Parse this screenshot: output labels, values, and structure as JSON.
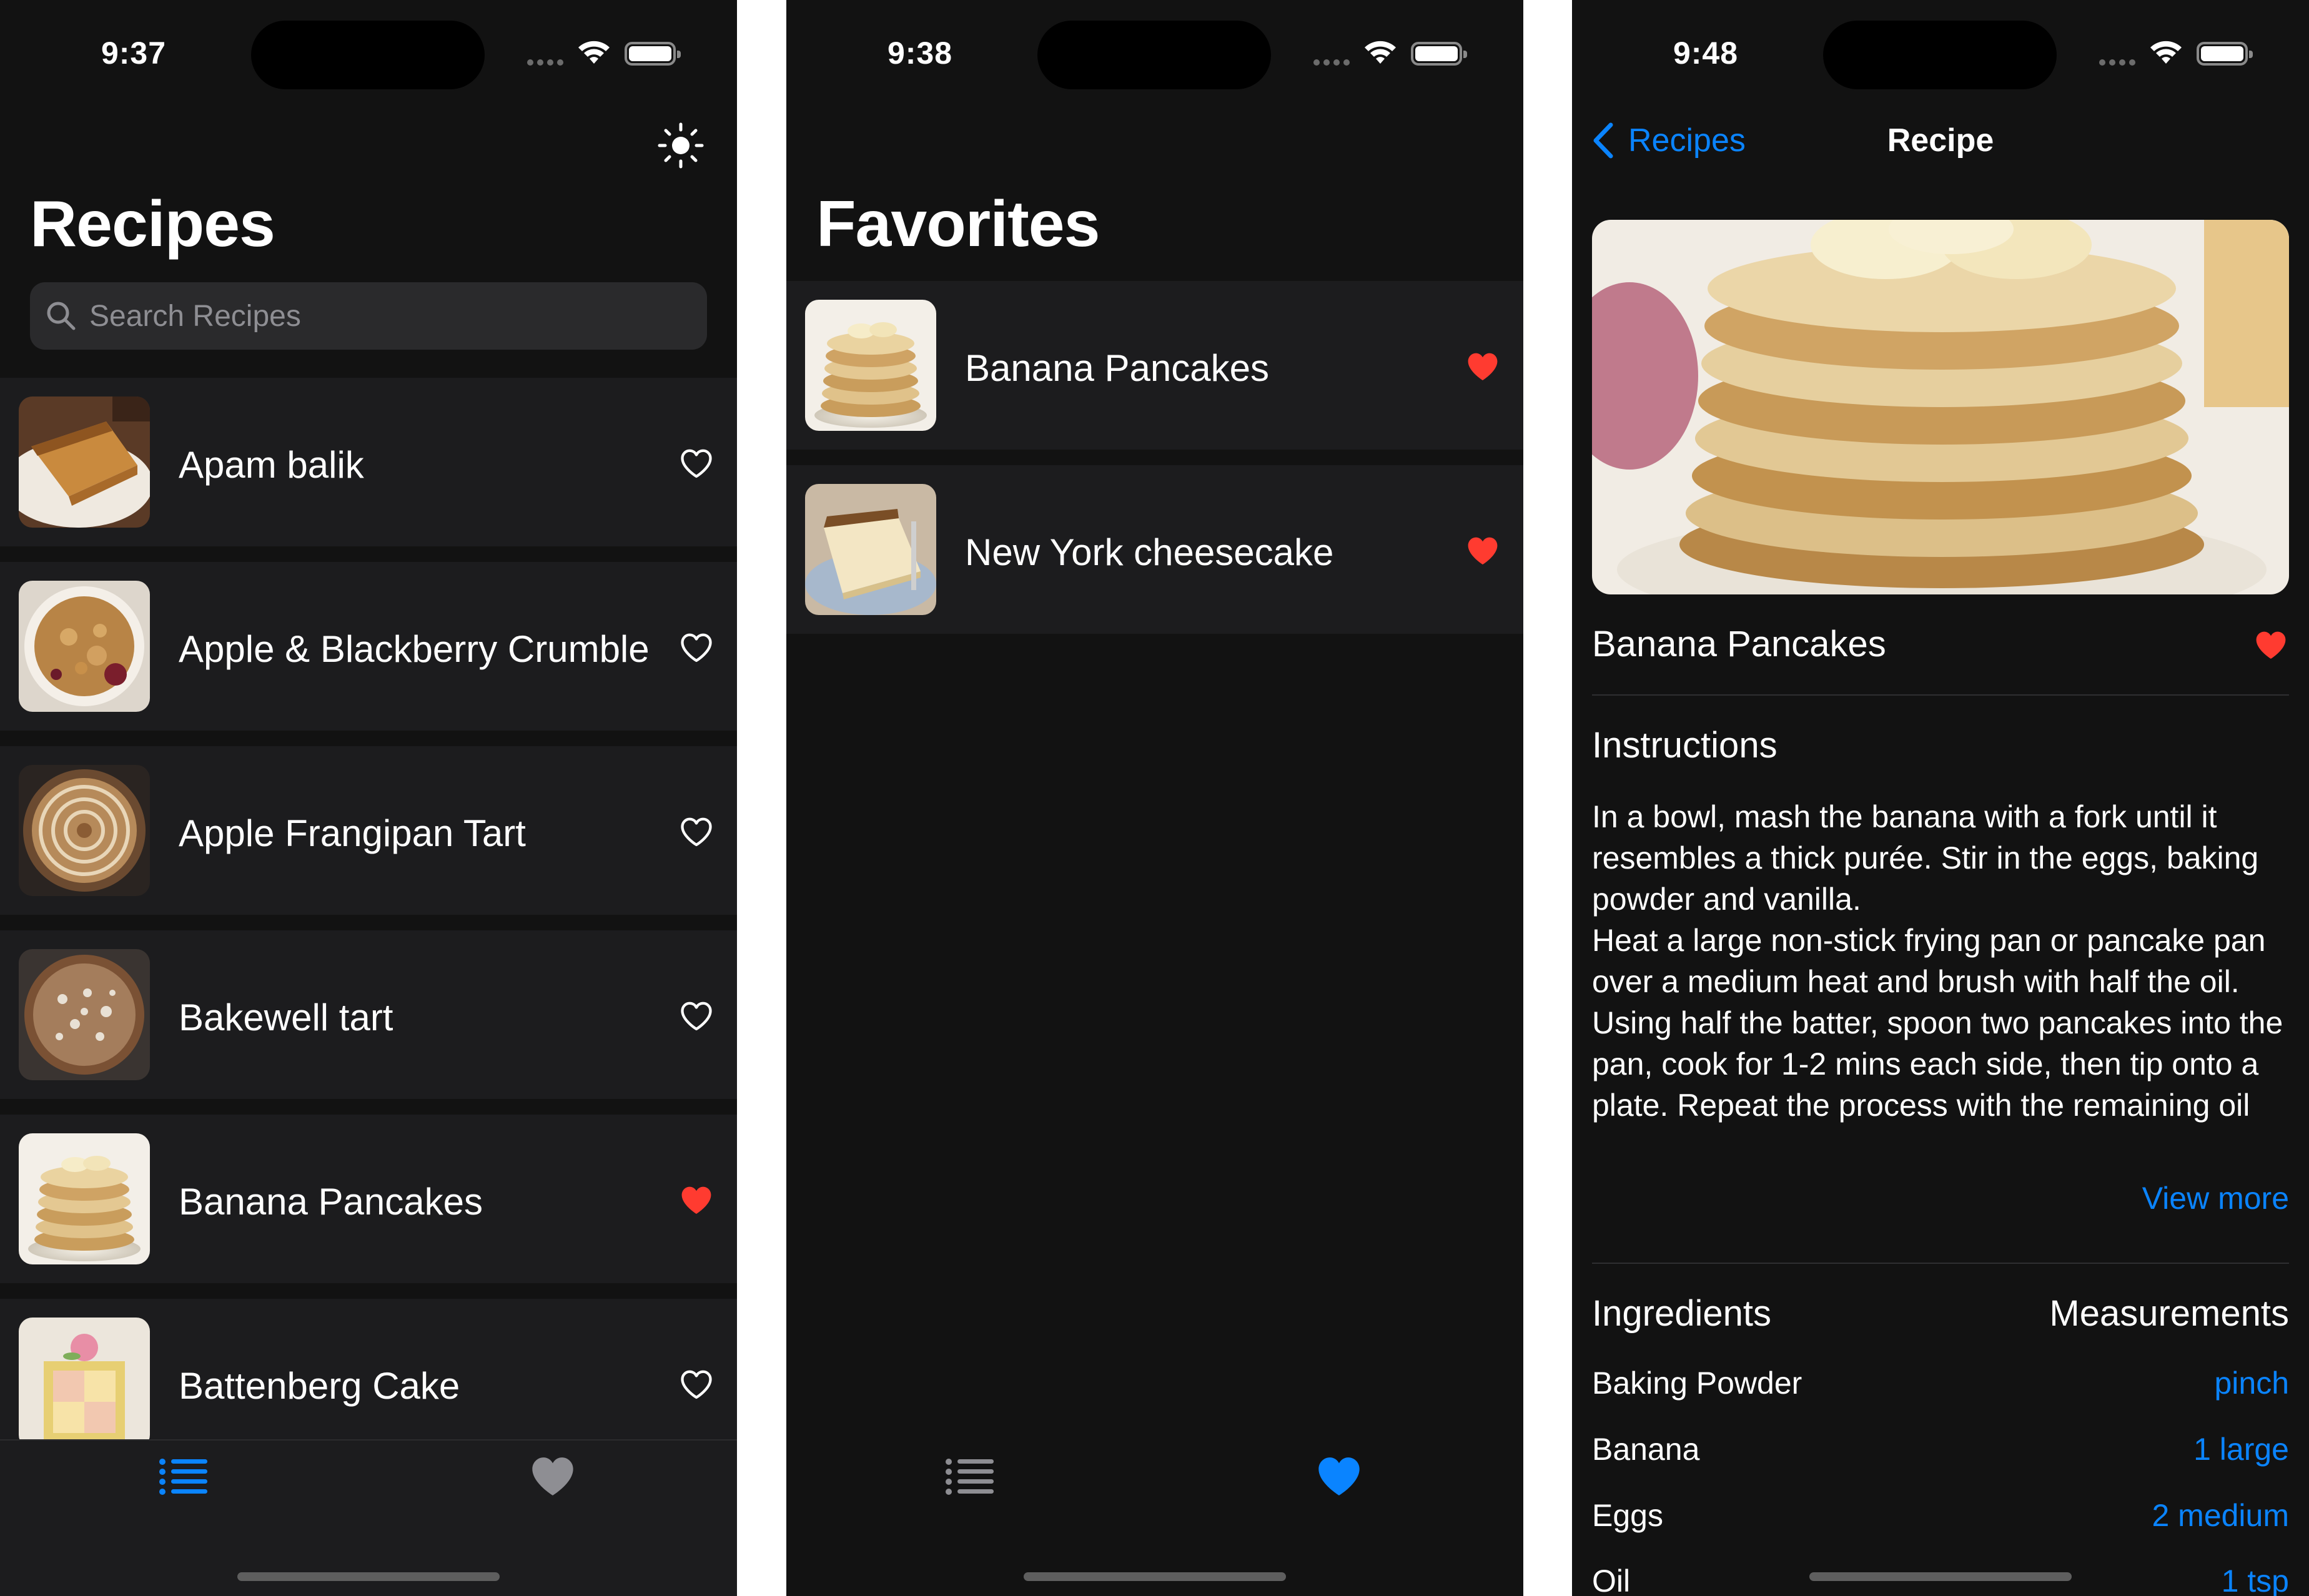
{
  "colors": {
    "background": "#121212",
    "row": "#1c1c1e",
    "accent": "#0a84ff",
    "favorite": "#ff3b30"
  },
  "screen1": {
    "status": {
      "time": "9:37"
    },
    "header": {
      "title": "Recipes",
      "theme_icon": "sun-icon"
    },
    "search": {
      "placeholder": "Search Recipes"
    },
    "recipes": [
      {
        "name": "Apam balik",
        "favorite": false
      },
      {
        "name": "Apple & Blackberry Crumble",
        "favorite": false
      },
      {
        "name": "Apple Frangipan Tart",
        "favorite": false
      },
      {
        "name": "Bakewell tart",
        "favorite": false
      },
      {
        "name": "Banana Pancakes",
        "favorite": true
      },
      {
        "name": "Battenberg Cake",
        "favorite": false
      }
    ],
    "tabbar": {
      "tabs": [
        {
          "icon": "list-icon",
          "selected": true
        },
        {
          "icon": "heart-icon",
          "selected": false
        }
      ]
    }
  },
  "screen2": {
    "status": {
      "time": "9:38"
    },
    "header": {
      "title": "Favorites"
    },
    "favorites": [
      {
        "name": "Banana Pancakes",
        "favorite": true
      },
      {
        "name": "New York cheesecake",
        "favorite": true
      }
    ],
    "tabbar": {
      "tabs": [
        {
          "icon": "list-icon",
          "selected": false
        },
        {
          "icon": "heart-icon",
          "selected": true
        }
      ]
    }
  },
  "screen3": {
    "status": {
      "time": "9:48"
    },
    "nav": {
      "back_label": "Recipes",
      "title": "Recipe"
    },
    "recipe": {
      "name": "Banana Pancakes",
      "favorite": true
    },
    "instructions": {
      "heading": "Instructions",
      "text": "In a bowl, mash the banana with a fork until it resembles a thick purée. Stir in the eggs, baking powder and vanilla.\nHeat a large non-stick frying pan or pancake pan over a medium heat and brush with half the oil. Using half the batter, spoon two pancakes into the pan, cook for 1-2 mins each side, then tip onto a plate. Repeat the process with the remaining oil and batter. Top the pancakes with...",
      "view_more": "View more"
    },
    "ingredients": {
      "heading": "Ingredients",
      "measurements_heading": "Measurements",
      "items": [
        {
          "name": "Baking Powder",
          "measure": "pinch"
        },
        {
          "name": "Banana",
          "measure": "1 large"
        },
        {
          "name": "Eggs",
          "measure": "2 medium"
        },
        {
          "name": "Oil",
          "measure": "1 tsp"
        }
      ]
    }
  }
}
